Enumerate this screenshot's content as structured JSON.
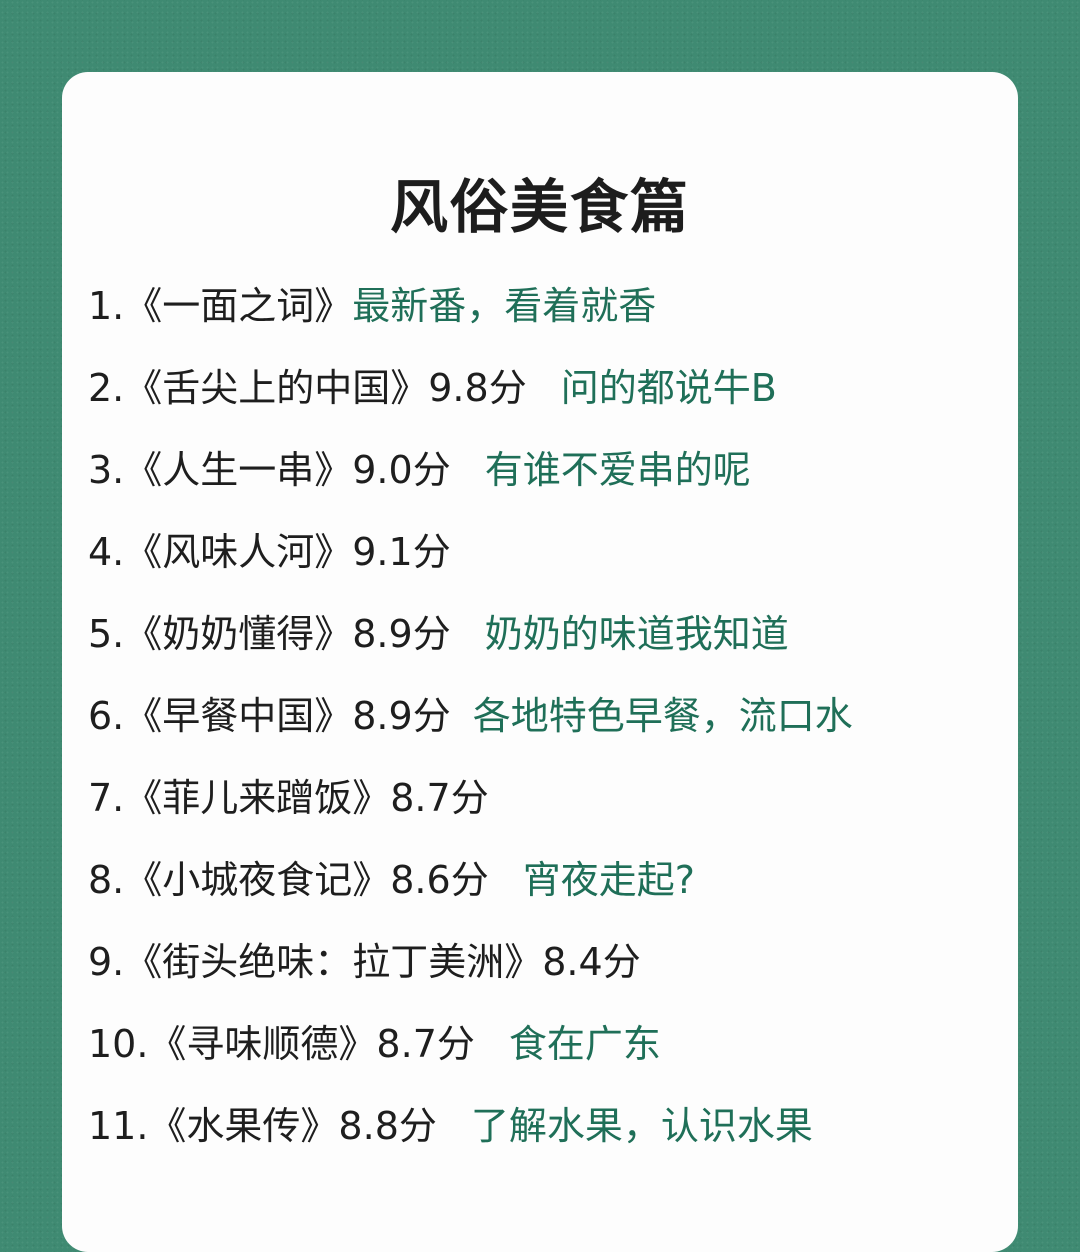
{
  "title": "风俗美食篇",
  "items": [
    {
      "main": "1.《一面之词》",
      "note": "最新番，看着就香"
    },
    {
      "main": "2.《舌尖上的中国》9.8分",
      "note": "问的都说牛B"
    },
    {
      "main": "3.《人生一串》9.0分",
      "note": "有谁不爱串的呢"
    },
    {
      "main": "4.《风味人河》9.1分",
      "note": ""
    },
    {
      "main": "5.《奶奶懂得》8.9分",
      "note": "奶奶的味道我知道"
    },
    {
      "main": "6.《早餐中国》8.9分",
      "note": "各地特色早餐，流口水"
    },
    {
      "main": "7.《菲儿来蹭饭》8.7分",
      "note": ""
    },
    {
      "main": "8.《小城夜食记》8.6分",
      "note": "宵夜走起?"
    },
    {
      "main": "9.《街头绝味：拉丁美洲》8.4分",
      "note": ""
    },
    {
      "main": "10.《寻味顺德》8.7分",
      "note": "食在广东"
    },
    {
      "main": "11.《水果传》8.8分",
      "note": "了解水果，认识水果"
    }
  ],
  "colors": {
    "background": "#3f8a72",
    "card": "#fdfdfd",
    "text": "#1e1e1e",
    "note": "#1f6f58"
  }
}
